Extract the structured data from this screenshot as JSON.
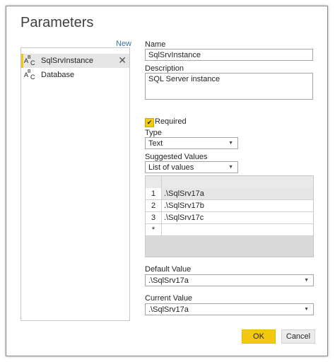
{
  "dialog": {
    "title": "Parameters",
    "new_label": "New"
  },
  "parameters": [
    {
      "name": "SqlSrvInstance",
      "type_icon": "abc-text-icon",
      "selected": true
    },
    {
      "name": "Database",
      "type_icon": "abc-text-icon",
      "selected": false
    }
  ],
  "type_icon_text": {
    "a": "A",
    "b": "B",
    "c": "C"
  },
  "form": {
    "name_label": "Name",
    "name_value": "SqlSrvInstance",
    "description_label": "Description",
    "description_value": "SQL Server instance",
    "required_label": "Required",
    "required_checked": true,
    "type_label": "Type",
    "type_value": "Text",
    "suggested_label": "Suggested Values",
    "suggested_value": "List of values",
    "values_table": {
      "rows": [
        {
          "num": "1",
          "value": ".\\SqlSrv17a"
        },
        {
          "num": "2",
          "value": ".\\SqlSrv17b"
        },
        {
          "num": "3",
          "value": ".\\SqlSrv17c"
        },
        {
          "num": "*",
          "value": ""
        }
      ]
    },
    "default_label": "Default Value",
    "default_value": ".\\SqlSrv17a",
    "current_label": "Current Value",
    "current_value": ".\\SqlSrv17a"
  },
  "buttons": {
    "ok": "OK",
    "cancel": "Cancel"
  },
  "colors": {
    "accent": "#f2c811",
    "link": "#3a6ea5"
  }
}
